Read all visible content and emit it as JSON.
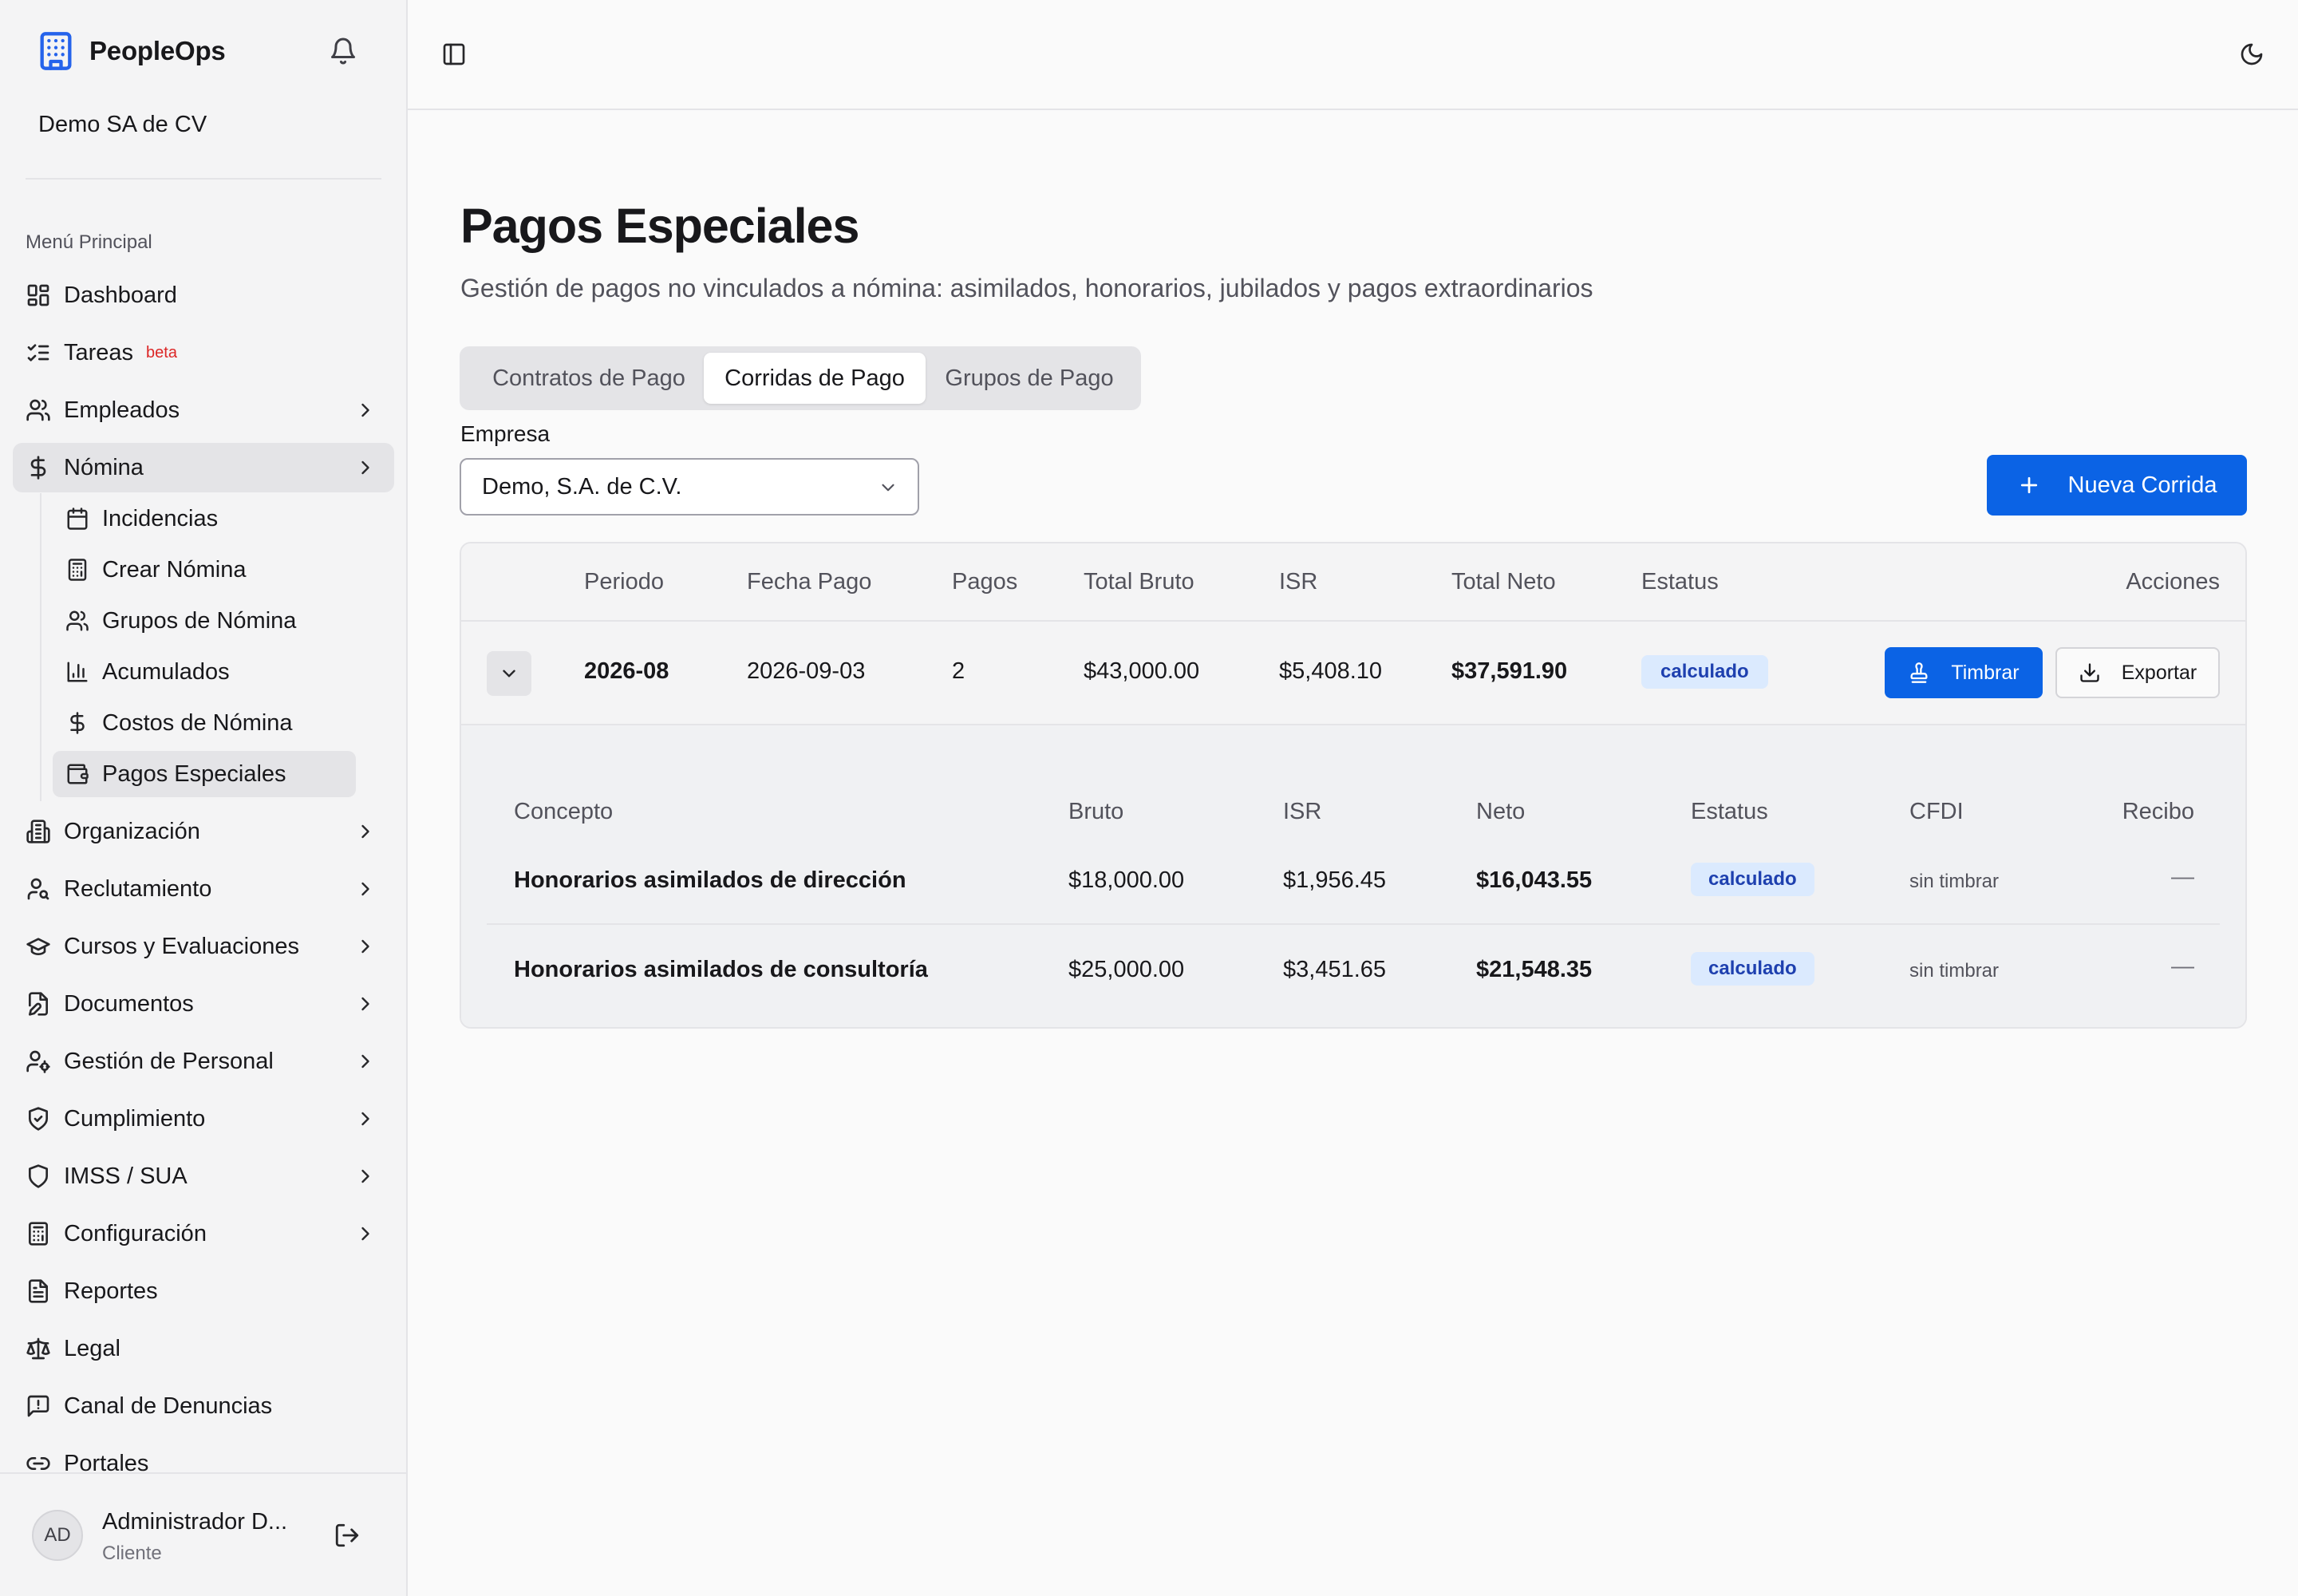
{
  "sidebar": {
    "app_name": "PeopleOps",
    "company": "Demo SA de CV",
    "section_label": "Menú Principal",
    "items": [
      {
        "label": "Dashboard"
      },
      {
        "label": "Tareas",
        "badge": "beta"
      },
      {
        "label": "Empleados"
      },
      {
        "label": "Nómina"
      },
      {
        "label": "Organización"
      },
      {
        "label": "Reclutamiento"
      },
      {
        "label": "Cursos y Evaluaciones"
      },
      {
        "label": "Documentos"
      },
      {
        "label": "Gestión de Personal"
      },
      {
        "label": "Cumplimiento"
      },
      {
        "label": "IMSS / SUA"
      },
      {
        "label": "Configuración"
      },
      {
        "label": "Reportes"
      },
      {
        "label": "Legal"
      },
      {
        "label": "Canal de Denuncias"
      },
      {
        "label": "Portales"
      }
    ],
    "nomina_sub": [
      {
        "label": "Incidencias"
      },
      {
        "label": "Crear Nómina"
      },
      {
        "label": "Grupos de Nómina"
      },
      {
        "label": "Acumulados"
      },
      {
        "label": "Costos de Nómina"
      },
      {
        "label": "Pagos Especiales"
      }
    ],
    "user": {
      "initials": "AD",
      "name": "Administrador D...",
      "role": "Cliente"
    }
  },
  "page": {
    "title": "Pagos Especiales",
    "subtitle": "Gestión de pagos no vinculados a nómina: asimilados, honorarios, jubilados y pagos extraordinarios",
    "tabs": [
      "Contratos de Pago",
      "Corridas de Pago",
      "Grupos de Pago"
    ],
    "active_tab": "Corridas de Pago",
    "empresa_label": "Empresa",
    "empresa_value": "Demo, S.A. de C.V.",
    "new_button": "Nueva Corrida"
  },
  "runs_table": {
    "columns": [
      "Periodo",
      "Fecha Pago",
      "Pagos",
      "Total Bruto",
      "ISR",
      "Total Neto",
      "Estatus",
      "Acciones"
    ],
    "rows": [
      {
        "periodo": "2026-08",
        "fecha_pago": "2026-09-03",
        "pagos": "2",
        "total_bruto": "$43,000.00",
        "isr": "$5,408.10",
        "total_neto": "$37,591.90",
        "estatus": "calculado",
        "timbrar_label": "Timbrar",
        "exportar_label": "Exportar"
      }
    ]
  },
  "detail_table": {
    "columns": [
      "Concepto",
      "Bruto",
      "ISR",
      "Neto",
      "Estatus",
      "CFDI",
      "Recibo"
    ],
    "rows": [
      {
        "concepto": "Honorarios asimilados de dirección",
        "bruto": "$18,000.00",
        "isr": "$1,956.45",
        "neto": "$16,043.55",
        "estatus": "calculado",
        "cfdi": "sin timbrar",
        "recibo": "—"
      },
      {
        "concepto": "Honorarios asimilados de consultoría",
        "bruto": "$25,000.00",
        "isr": "$3,451.65",
        "neto": "$21,548.35",
        "estatus": "calculado",
        "cfdi": "sin timbrar",
        "recibo": "—"
      }
    ]
  },
  "colors": {
    "accent": "#0b63e5",
    "badge_bg": "#dbeafe",
    "badge_text": "#1e40af",
    "beta": "#dc2626"
  }
}
